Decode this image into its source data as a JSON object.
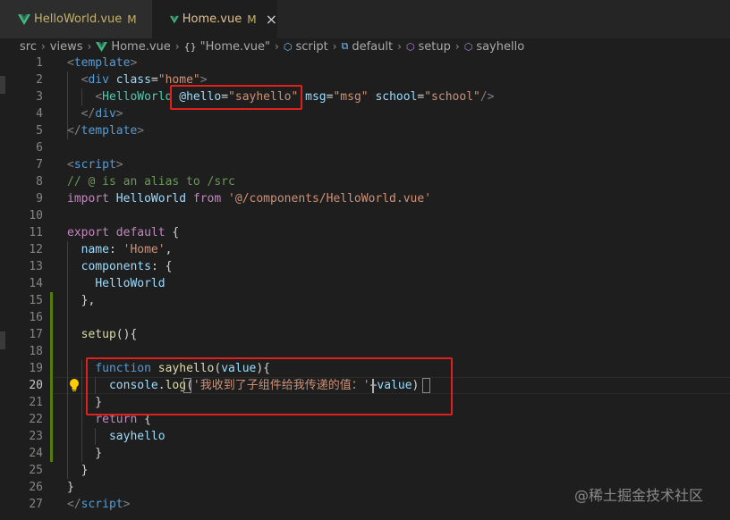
{
  "tabs": [
    {
      "name": "HelloWorld.vue",
      "status": "M",
      "active": false
    },
    {
      "name": "Home.vue",
      "status": "M",
      "active": true
    }
  ],
  "tab_close_glyph": "×",
  "breadcrumb": {
    "items": [
      "src",
      "views",
      "Home.vue",
      "\"Home.vue\"",
      "script",
      "default",
      "setup",
      "sayhello"
    ],
    "icons": [
      "",
      "",
      "vue-icon",
      "braces-icon",
      "cube-icon",
      "module-icon",
      "cube-icon",
      "cube-icon"
    ]
  },
  "editor": {
    "current_line": 20,
    "lines": [
      {
        "n": 1,
        "tokens": [
          [
            "t-punc",
            "<"
          ],
          [
            "t-tag",
            "template"
          ],
          [
            "t-punc",
            ">"
          ]
        ]
      },
      {
        "n": 2,
        "tokens": [
          [
            "",
            "  "
          ],
          [
            "t-punc",
            "<"
          ],
          [
            "t-tag",
            "div"
          ],
          [
            "",
            " "
          ],
          [
            "t-attr",
            "class"
          ],
          [
            "",
            "="
          ],
          [
            "t-str",
            "\"home\""
          ],
          [
            "t-punc",
            ">"
          ]
        ]
      },
      {
        "n": 3,
        "tokens": [
          [
            "",
            "    "
          ],
          [
            "t-punc",
            "<"
          ],
          [
            "t-comp",
            "HelloWorld"
          ],
          [
            "",
            " "
          ],
          [
            "t-attr",
            "@hello"
          ],
          [
            "",
            "="
          ],
          [
            "t-str",
            "\"sayhello\""
          ],
          [
            "",
            " "
          ],
          [
            "t-attr",
            "msg"
          ],
          [
            "",
            "="
          ],
          [
            "t-str",
            "\"msg\""
          ],
          [
            "",
            " "
          ],
          [
            "t-attr",
            "school"
          ],
          [
            "",
            "="
          ],
          [
            "t-str",
            "\"school\""
          ],
          [
            "t-punc",
            "/>"
          ]
        ]
      },
      {
        "n": 4,
        "tokens": [
          [
            "",
            "  "
          ],
          [
            "t-punc",
            "</"
          ],
          [
            "t-tag",
            "div"
          ],
          [
            "t-punc",
            ">"
          ]
        ]
      },
      {
        "n": 5,
        "tokens": [
          [
            "t-punc",
            "</"
          ],
          [
            "t-tag",
            "template"
          ],
          [
            "t-punc",
            ">"
          ]
        ]
      },
      {
        "n": 6,
        "tokens": []
      },
      {
        "n": 7,
        "tokens": [
          [
            "t-punc",
            "<"
          ],
          [
            "t-tag",
            "script"
          ],
          [
            "t-punc",
            ">"
          ]
        ]
      },
      {
        "n": 8,
        "tokens": [
          [
            "t-com",
            "// @ is an alias to /src"
          ]
        ]
      },
      {
        "n": 9,
        "tokens": [
          [
            "t-kw",
            "import"
          ],
          [
            "",
            " "
          ],
          [
            "t-attr",
            "HelloWorld"
          ],
          [
            "",
            " "
          ],
          [
            "t-kw",
            "from"
          ],
          [
            "",
            " "
          ],
          [
            "t-str",
            "'@/components/HelloWorld.vue'"
          ]
        ]
      },
      {
        "n": 10,
        "tokens": []
      },
      {
        "n": 11,
        "tokens": [
          [
            "t-kw",
            "export"
          ],
          [
            "",
            " "
          ],
          [
            "t-kw",
            "default"
          ],
          [
            "",
            " {"
          ]
        ]
      },
      {
        "n": 12,
        "tokens": [
          [
            "",
            "  "
          ],
          [
            "t-attr",
            "name"
          ],
          [
            "",
            ": "
          ],
          [
            "t-str",
            "'Home'"
          ],
          [
            "",
            ","
          ]
        ]
      },
      {
        "n": 13,
        "tokens": [
          [
            "",
            "  "
          ],
          [
            "t-attr",
            "components"
          ],
          [
            "",
            ": {"
          ]
        ]
      },
      {
        "n": 14,
        "tokens": [
          [
            "",
            "    "
          ],
          [
            "t-attr",
            "HelloWorld"
          ]
        ]
      },
      {
        "n": 15,
        "tokens": [
          [
            "",
            "  },"
          ]
        ]
      },
      {
        "n": 16,
        "tokens": []
      },
      {
        "n": 17,
        "tokens": [
          [
            "",
            "  "
          ],
          [
            "t-fn",
            "setup"
          ],
          [
            "",
            "(){"
          ]
        ]
      },
      {
        "n": 18,
        "tokens": []
      },
      {
        "n": 19,
        "tokens": [
          [
            "",
            "    "
          ],
          [
            "t-kwb",
            "function"
          ],
          [
            "",
            " "
          ],
          [
            "t-fn",
            "sayhello"
          ],
          [
            "",
            "("
          ],
          [
            "t-attr",
            "value"
          ],
          [
            "",
            "){"
          ]
        ]
      },
      {
        "n": 20,
        "tokens": [
          [
            "",
            "      "
          ],
          [
            "t-attr",
            "console"
          ],
          [
            "",
            "."
          ],
          [
            "t-fn",
            "log"
          ],
          [
            "",
            "("
          ],
          [
            "t-str",
            "'我收到了子组件给我传递的值：'"
          ],
          [
            "",
            "+"
          ],
          [
            "t-attr",
            "value"
          ],
          [
            "",
            ")"
          ]
        ]
      },
      {
        "n": 21,
        "tokens": [
          [
            "",
            "    }"
          ]
        ]
      },
      {
        "n": 22,
        "tokens": [
          [
            "",
            "    "
          ],
          [
            "t-kw",
            "return"
          ],
          [
            "",
            " {"
          ]
        ]
      },
      {
        "n": 23,
        "tokens": [
          [
            "",
            "      "
          ],
          [
            "t-attr",
            "sayhello"
          ]
        ]
      },
      {
        "n": 24,
        "tokens": [
          [
            "",
            "    }"
          ]
        ]
      },
      {
        "n": 25,
        "tokens": [
          [
            "",
            "  }"
          ]
        ]
      },
      {
        "n": 26,
        "tokens": [
          [
            "",
            "}"
          ]
        ]
      },
      {
        "n": 27,
        "tokens": [
          [
            "t-punc",
            "</"
          ],
          [
            "t-tag",
            "script"
          ],
          [
            "t-punc",
            ">"
          ]
        ]
      }
    ]
  },
  "watermark": "@稀土掘金技术社区",
  "colors": {
    "highlight_box": "#e0201c",
    "vue_green": "#41b883",
    "git_modified": "#587c0c"
  }
}
